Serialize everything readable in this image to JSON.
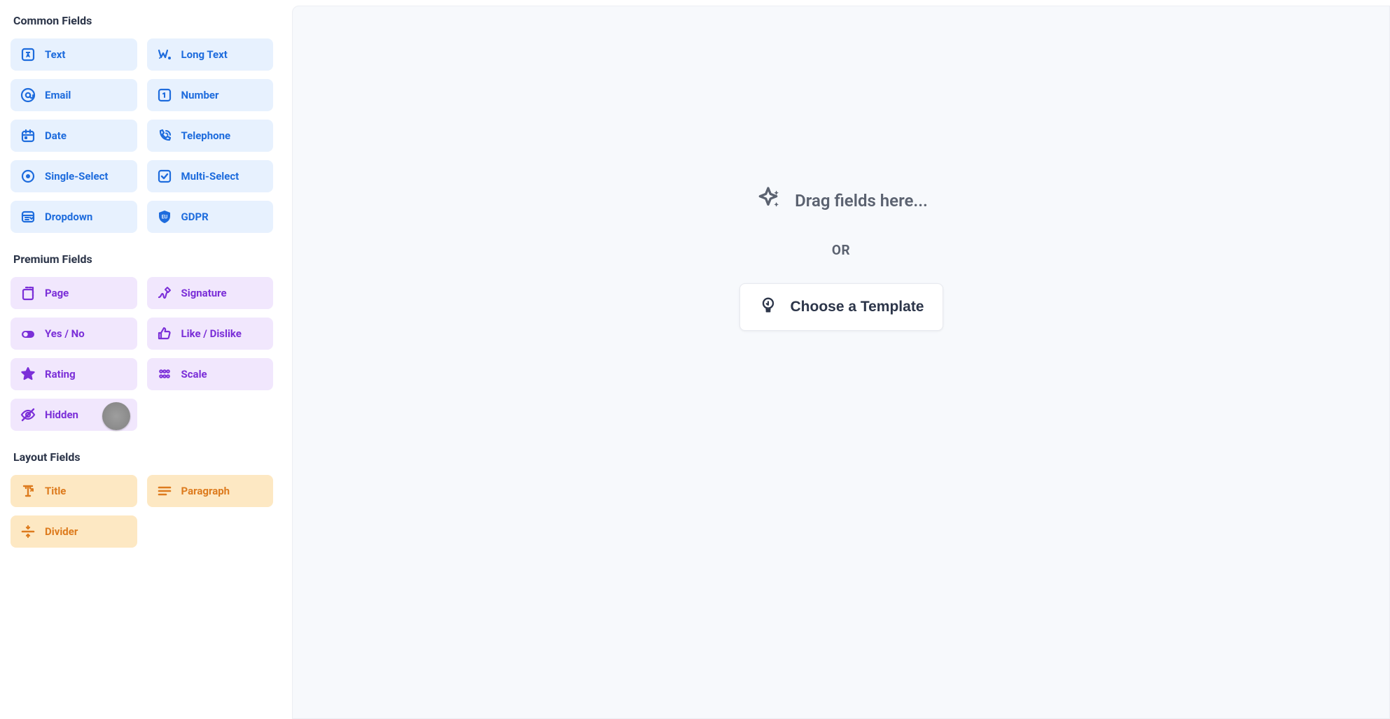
{
  "sidebar": {
    "sections": [
      {
        "title": "Common Fields",
        "variant": "common",
        "items": [
          {
            "label": "Text",
            "icon": "text-icon"
          },
          {
            "label": "Long Text",
            "icon": "long-text-icon"
          },
          {
            "label": "Email",
            "icon": "email-icon"
          },
          {
            "label": "Number",
            "icon": "number-icon"
          },
          {
            "label": "Date",
            "icon": "date-icon"
          },
          {
            "label": "Telephone",
            "icon": "telephone-icon"
          },
          {
            "label": "Single-Select",
            "icon": "single-select-icon"
          },
          {
            "label": "Multi-Select",
            "icon": "multi-select-icon"
          },
          {
            "label": "Dropdown",
            "icon": "dropdown-icon"
          },
          {
            "label": "GDPR",
            "icon": "gdpr-icon"
          }
        ]
      },
      {
        "title": "Premium Fields",
        "variant": "premium",
        "items": [
          {
            "label": "Page",
            "icon": "page-icon"
          },
          {
            "label": "Signature",
            "icon": "signature-icon"
          },
          {
            "label": "Yes / No",
            "icon": "yes-no-icon"
          },
          {
            "label": "Like / Dislike",
            "icon": "like-dislike-icon"
          },
          {
            "label": "Rating",
            "icon": "rating-icon"
          },
          {
            "label": "Scale",
            "icon": "scale-icon"
          },
          {
            "label": "Hidden",
            "icon": "hidden-icon",
            "showCursor": true
          }
        ]
      },
      {
        "title": "Layout Fields",
        "variant": "layout",
        "items": [
          {
            "label": "Title",
            "icon": "title-icon"
          },
          {
            "label": "Paragraph",
            "icon": "paragraph-icon"
          },
          {
            "label": "Divider",
            "icon": "divider-icon"
          }
        ]
      }
    ]
  },
  "canvas": {
    "dropHint": "Drag fields here...",
    "or": "OR",
    "templateButton": "Choose a Template"
  }
}
